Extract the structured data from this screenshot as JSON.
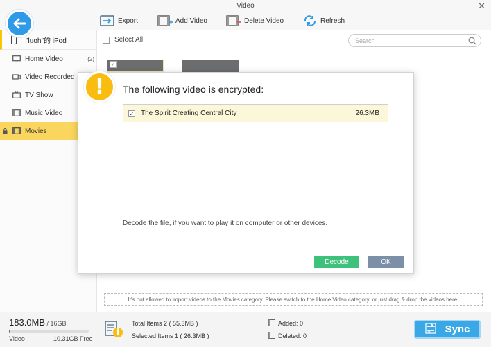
{
  "window": {
    "title": "Video",
    "close_glyph": "✕"
  },
  "toolbar": {
    "export_label": "Export",
    "add_label": "Add Video",
    "delete_label": "Delete Video",
    "refresh_label": "Refresh"
  },
  "sidebar": {
    "device_name": "\"luoh\"的 iPod",
    "items": [
      {
        "label": "Home Video",
        "count": "(2)",
        "icon": "home-video-icon"
      },
      {
        "label": "Video Recorded",
        "count": "",
        "icon": "video-camera-icon"
      },
      {
        "label": "TV Show",
        "count": "",
        "icon": "tv-icon"
      },
      {
        "label": "Music Video",
        "count": "",
        "icon": "music-video-icon"
      },
      {
        "label": "Movies",
        "count": "",
        "icon": "film-icon"
      }
    ]
  },
  "content": {
    "select_all_label": "Select All",
    "search_placeholder": "Search",
    "notice": "It's not allowed to  import videos to the Movies category.  Please switch to the Home Video category, or just drag & drop the videos here."
  },
  "dialog": {
    "icon": "!",
    "title": "The following video is encrypted:",
    "files": [
      {
        "name": "The Spirit Creating Central City",
        "size": "26.3MB",
        "checked": true
      }
    ],
    "hint": "Decode the file, if you want to play it on computer or other devices.",
    "decode_label": "Decode",
    "ok_label": "OK"
  },
  "status": {
    "used": "183.0MB",
    "total": " / 16GB",
    "used_fraction": 0.011,
    "category": "Video",
    "free": "10.31GB Free",
    "total_items": "Total Items 2 ( 55.3MB )",
    "selected_items": "Selected Items 1 ( 26.3MB )",
    "added": "Added: 0",
    "deleted": "Deleted: 0",
    "sync_label": "Sync"
  },
  "colors": {
    "accent_blue": "#2f9be8",
    "highlight_yellow": "#fbd65f",
    "warning": "#f9bc11",
    "decode_green": "#3dc17b",
    "ok_gray": "#7b8fa6"
  }
}
